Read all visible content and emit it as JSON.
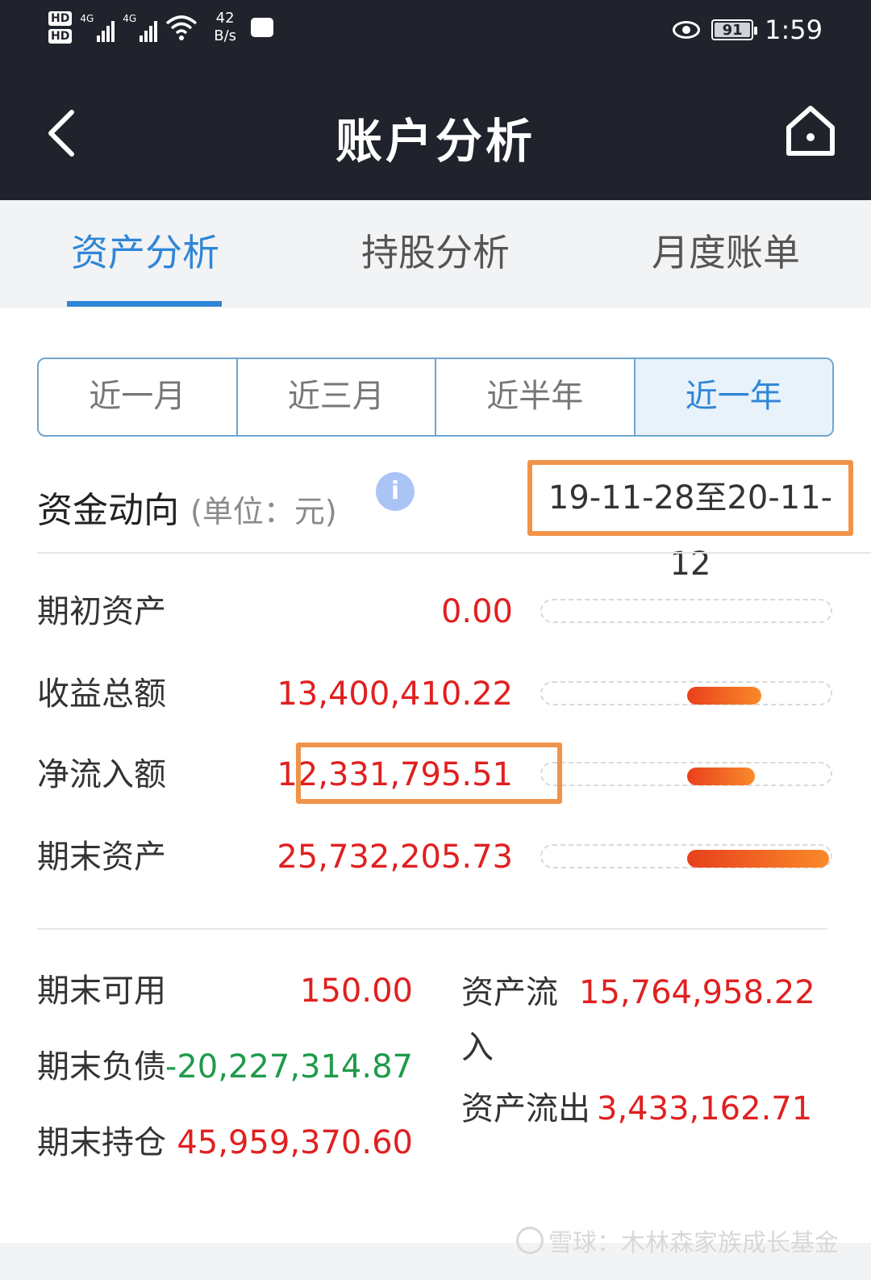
{
  "status_bar": {
    "hd1": "HD",
    "hd2": "HD",
    "sim1_net": "4G",
    "sim2_net": "4G",
    "speed_value": "42",
    "speed_unit": "B/s",
    "battery": "91",
    "time": "1:59"
  },
  "nav": {
    "title": "账户分析",
    "back_icon": "chevron-left-icon",
    "home_icon": "home-icon"
  },
  "tabs": [
    {
      "label": "资产分析",
      "active": true
    },
    {
      "label": "持股分析",
      "active": false
    },
    {
      "label": "月度账单",
      "active": false
    }
  ],
  "periods": [
    {
      "label": "近一月",
      "active": false
    },
    {
      "label": "近三月",
      "active": false
    },
    {
      "label": "近半年",
      "active": false
    },
    {
      "label": "近一年",
      "active": true
    }
  ],
  "section": {
    "title": "资金动向",
    "unit": "(单位：元)",
    "info_icon": "info-icon",
    "date_range": "19-11-28至20-11-12"
  },
  "flow_rows": [
    {
      "label": "期初资产",
      "value": "0.00",
      "bar_fraction": 0
    },
    {
      "label": "收益总额",
      "value": "13,400,410.22",
      "bar_fraction": 0.52
    },
    {
      "label": "净流入额",
      "value": "12,331,795.51",
      "bar_fraction": 0.48
    },
    {
      "label": "期末资产",
      "value": "25,732,205.73",
      "bar_fraction": 1.0
    }
  ],
  "summary_left": [
    {
      "label": "期末可用",
      "value": "150.00",
      "color": "red"
    },
    {
      "label": "期末负债",
      "value": "-20,227,314.87",
      "color": "green"
    },
    {
      "label": "期末持仓",
      "value": "45,959,370.60",
      "color": "red"
    }
  ],
  "summary_right": [
    {
      "label_line1": "资产流",
      "label_line2": "入",
      "value": "15,764,958.22"
    },
    {
      "label": "资产流出",
      "value": "3,433,162.71"
    }
  ],
  "colors": {
    "header_bg": "#20232b",
    "accent_blue": "#2f86d6",
    "value_red": "#e02020",
    "value_green": "#1f9a4a",
    "highlight_orange": "#f0934a",
    "bar_orange": "#f98a2a"
  },
  "watermark": "雪球：木林森家族成长基金"
}
